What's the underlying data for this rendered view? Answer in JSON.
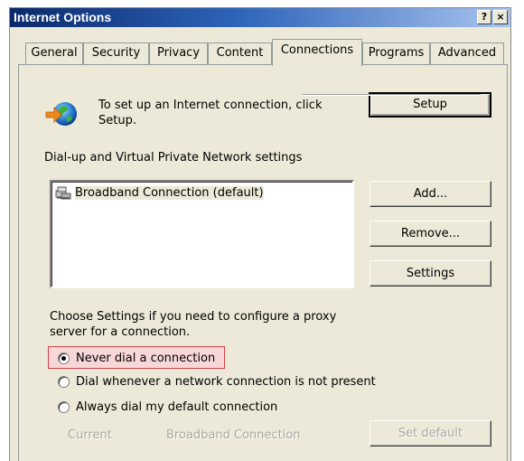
{
  "window": {
    "title": "Internet Options",
    "help_glyph": "?",
    "close_glyph": "×"
  },
  "tabs": [
    {
      "label": "General"
    },
    {
      "label": "Security"
    },
    {
      "label": "Privacy"
    },
    {
      "label": "Content"
    },
    {
      "label": "Connections"
    },
    {
      "label": "Programs"
    },
    {
      "label": "Advanced"
    }
  ],
  "active_tab": "Connections",
  "setup": {
    "description": "To set up an Internet connection, click Setup.",
    "button": "Setup",
    "icon": "globe-icon"
  },
  "dialup": {
    "group_label": "Dial-up and Virtual Private Network settings",
    "connections": [
      {
        "name": "Broadband Connection (default)",
        "icon": "connection-icon"
      }
    ],
    "add_button": "Add...",
    "remove_button": "Remove...",
    "settings_button": "Settings"
  },
  "proxy_note": "Choose Settings if you need to configure a proxy server for a connection.",
  "dial_options": [
    {
      "label": "Never dial a connection",
      "selected": true
    },
    {
      "label": "Dial whenever a network connection is not present",
      "selected": false
    },
    {
      "label": "Always dial my default connection",
      "selected": false
    }
  ],
  "current": {
    "label": "Current",
    "value": "Broadband Connection",
    "set_default_button": "Set default"
  },
  "colors": {
    "highlight_border": "#d0404a",
    "highlight_fill": "#f8d7d9",
    "title_gradient_start": "#0a2a6b"
  }
}
